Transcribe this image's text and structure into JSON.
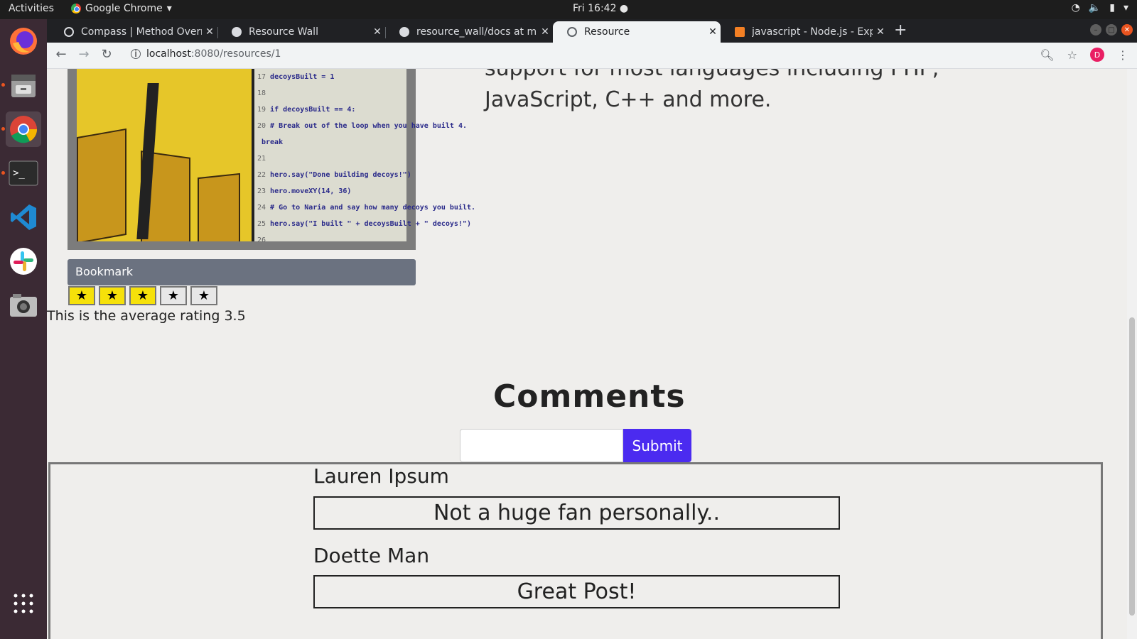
{
  "os": {
    "activities": "Activities",
    "app_name": "Google Chrome",
    "clock": "Fri 16:42"
  },
  "dock": {
    "items": [
      "firefox-icon",
      "files-icon",
      "chrome-icon",
      "terminal-icon",
      "vscode-icon",
      "slack-icon",
      "camera-icon",
      "app-grid-icon"
    ]
  },
  "browser": {
    "tabs": [
      {
        "title": "Compass | Method Overri",
        "icon": "compass-icon"
      },
      {
        "title": "Resource Wall",
        "icon": "github-icon"
      },
      {
        "title": "resource_wall/docs at ma",
        "icon": "github-icon"
      },
      {
        "title": "Resource",
        "icon": "globe-icon",
        "active": true
      },
      {
        "title": "javascript - Node.js - Expr",
        "icon": "stackoverflow-icon"
      }
    ],
    "url_host": "localhost",
    "url_path": ":8080/resources/1",
    "avatar_letter": "D"
  },
  "page": {
    "description_line1": "support for most languages including PHP,",
    "description_line2": "JavaScript, C++ and more.",
    "bookmark_label": "Bookmark",
    "rating": {
      "filled": 3,
      "total": 5
    },
    "average_text": "This is the average rating 3.5",
    "comments_title": "Comments",
    "submit_label": "Submit",
    "comment_input_placeholder": "",
    "code_lines": [
      {
        "n": "17",
        "t": "decoysBuilt = 1"
      },
      {
        "n": "18",
        "t": ""
      },
      {
        "n": "19",
        "t": "if decoysBuilt == 4:"
      },
      {
        "n": "20",
        "t": "# Break out of the loop when you have built 4."
      },
      {
        "n": "",
        "t": "break"
      },
      {
        "n": "21",
        "t": ""
      },
      {
        "n": "22",
        "t": "hero.say(\"Done building decoys!\")"
      },
      {
        "n": "23",
        "t": "hero.moveXY(14, 36)"
      },
      {
        "n": "24",
        "t": "# Go to Naria and say how many decoys you built."
      },
      {
        "n": "25",
        "t": "hero.say(\"I built \" + decoysBuilt + \" decoys!\")"
      },
      {
        "n": "26",
        "t": ""
      }
    ],
    "comments": [
      {
        "author": "Lauren Ipsum",
        "text": "Not a huge fan personally.."
      },
      {
        "author": "Doette Man",
        "text": "Great Post!"
      }
    ]
  }
}
